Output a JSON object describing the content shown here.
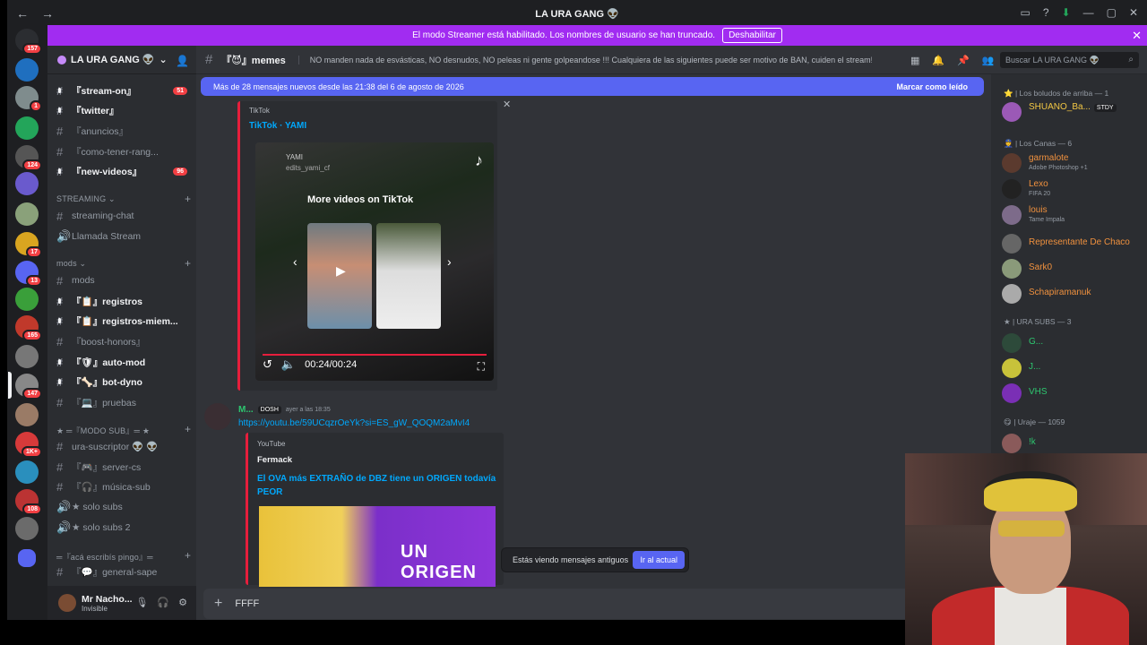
{
  "window": {
    "title": "LA URA GANG 👽",
    "back": "←",
    "forward": "→"
  },
  "banner": {
    "text": "El modo Streamer está habilitado. Los nombres de usuario se han truncado.",
    "button": "Deshabilitar",
    "close": "✕"
  },
  "servers": [
    {
      "badge": "157",
      "color": "#2b2d31"
    },
    {
      "badge": "",
      "color": "#1f6fbf"
    },
    {
      "badge": "1",
      "color": "#7f8c8d"
    },
    {
      "badge": "",
      "color": "#23a55a"
    },
    {
      "badge": "124",
      "color": "#555"
    },
    {
      "badge": "",
      "color": "#6a5acd"
    },
    {
      "badge": "",
      "color": "#8aa17a"
    },
    {
      "badge": "17",
      "color": "#d9a520"
    },
    {
      "badge": "13",
      "color": "#5865f2"
    },
    {
      "badge": "",
      "color": "#3a9f3a"
    },
    {
      "badge": "165",
      "color": "#c0392b"
    },
    {
      "badge": "",
      "color": "#777"
    },
    {
      "badge": "147",
      "color": "#888"
    },
    {
      "badge": "",
      "color": "#9a7b66"
    },
    {
      "badge": "1K+",
      "color": "#d73a3a"
    },
    {
      "badge": "",
      "color": "#2a8fbd"
    },
    {
      "badge": "108",
      "color": "#b33"
    },
    {
      "badge": "",
      "color": "#6b6b6b"
    }
  ],
  "guild": {
    "name": "LA URA GANG 👽"
  },
  "channels": [
    {
      "label": "『stream-on』",
      "unread": true,
      "count": "51"
    },
    {
      "label": "『twitter』",
      "unread": true,
      "count": ""
    },
    {
      "label": "『anuncios』",
      "unread": false,
      "count": ""
    },
    {
      "label": "『como-tener-rang...",
      "unread": false,
      "count": ""
    },
    {
      "label": "『new-videos』",
      "unread": true,
      "count": "96"
    }
  ],
  "cat_streaming": "STREAMING",
  "streaming_channels": [
    {
      "label": "streaming-chat"
    },
    {
      "label": "Llamada Stream"
    }
  ],
  "cat_mods": "mods",
  "mods_channels": [
    {
      "label": "mods",
      "unread": false
    },
    {
      "label": "『📋』registros",
      "unread": true
    },
    {
      "label": "『📋』registros-miem...",
      "unread": true
    },
    {
      "label": "『boost-honors』",
      "unread": false
    },
    {
      "label": "『🛡』auto-mod",
      "unread": true
    },
    {
      "label": "『🦴』bot-dyno",
      "unread": true
    },
    {
      "label": "『💻』pruebas",
      "unread": false
    }
  ],
  "cat_modsub": "★ ═『MODO SUB』═ ★",
  "modsub_channels": [
    {
      "label": "ura-suscriptor 👽 👽"
    },
    {
      "label": "『🎮』server-cs"
    },
    {
      "label": "『🎧』música-sub"
    },
    {
      "label": "★ solo subs"
    },
    {
      "label": "★ solo subs 2"
    }
  ],
  "cat_pingo": "═『acá escribís pingo』═",
  "pingo_channels": [
    {
      "label": "『💬』general-sape"
    }
  ],
  "user": {
    "name": "Mr Nacho...",
    "status": "Invisible"
  },
  "header": {
    "channel": "『😈』memes",
    "topic": "NO manden nada de esvásticas, NO desnudos, NO peleas ni gente golpeandose !!! Cualquiera de las siguientes puede ser motivo de BAN, cuiden el stream!",
    "search_placeholder": "Buscar LA URA GANG 👽"
  },
  "newbar": {
    "text": "Más de 28 mensajes nuevos desde las 21:38 del 6 de agosto de 2026",
    "mark": "Marcar como leído"
  },
  "embed1": {
    "provider": "TikTok",
    "title": "TikTok · YAMI",
    "author": "YAMI",
    "handle": "edits_yami_cf",
    "more": "More videos on TikTok",
    "time": "00:24/00:24"
  },
  "msg2": {
    "user": "M...",
    "tag": "DOSH",
    "time": "ayer a las 18:35",
    "link": "https://youtu.be/59UCqzrOeYk?si=ES_gW_QOQM2aMvI4",
    "provider": "YouTube",
    "author": "Fermack",
    "title": "El OVA más EXTRAÑO de DBZ tiene un ORIGEN todavía PEOR",
    "thumb_text": "UN ORIGEN"
  },
  "oldbar": {
    "text": "Estás viendo mensajes antiguos",
    "button": "Ir al actual"
  },
  "composer": {
    "text": "FFFF"
  },
  "members": {
    "cat1": "⭐ | Los boludos de arriba — 1",
    "m1": {
      "name": "SHUANO_Ba...",
      "tag": "STDY",
      "color": "#f2c744"
    },
    "cat2": "👮 | Los Canas — 6",
    "m2": {
      "name": "garmalote",
      "activity": "Adobe Photoshop +1",
      "color": "#f0913e"
    },
    "m3": {
      "name": "Lexo",
      "activity": "FIFA 20",
      "color": "#f0913e"
    },
    "m4": {
      "name": "louis",
      "activity": "Tame Impala",
      "color": "#f0913e"
    },
    "m5": {
      "name": "Representante De Chaco",
      "activity": "",
      "color": "#f0913e"
    },
    "m6": {
      "name": "Sark0",
      "activity": "",
      "color": "#f0913e"
    },
    "m7": {
      "name": "Schapiramanuk",
      "activity": "",
      "color": "#f0913e"
    },
    "cat3": "★ | URA SUBS — 3",
    "m8": {
      "name": "G...",
      "color": "#2dc770"
    },
    "m9": {
      "name": "J...",
      "color": "#2dc770"
    },
    "m10": {
      "name": "VHS",
      "color": "#2dc770"
    },
    "cat4": "😋 | Uraje — 1059",
    "m11": {
      "name": "!k",
      "color": "#2dc770"
    }
  }
}
